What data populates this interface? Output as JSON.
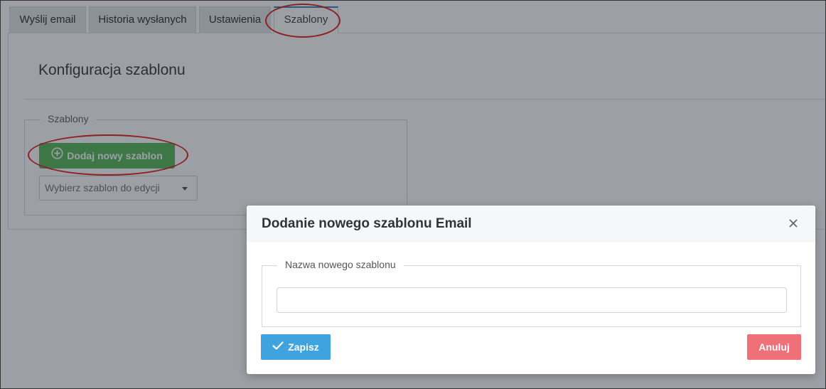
{
  "tabs": [
    {
      "label": "Wyślij email"
    },
    {
      "label": "Historia wysłanych"
    },
    {
      "label": "Ustawienia"
    },
    {
      "label": "Szablony"
    }
  ],
  "page": {
    "title": "Konfiguracja szablonu",
    "section_legend": "Szablony",
    "add_button_label": "Dodaj nowy szablon",
    "add_button_icon": "plus-circle-icon",
    "select_placeholder": "Wybierz szablon do edycji"
  },
  "modal": {
    "title": "Dodanie nowego szablonu Email",
    "close_icon": "close-icon",
    "field_legend": "Nazwa nowego szablonu",
    "input_value": "",
    "save_label": "Zapisz",
    "save_icon": "check-icon",
    "cancel_label": "Anuluj"
  },
  "colors": {
    "annotation_red": "#e02424",
    "add_green": "#5cb85c",
    "save_blue": "#3fa3e0",
    "cancel_red": "#f0707a",
    "active_tab_border": "#3a87c8"
  }
}
